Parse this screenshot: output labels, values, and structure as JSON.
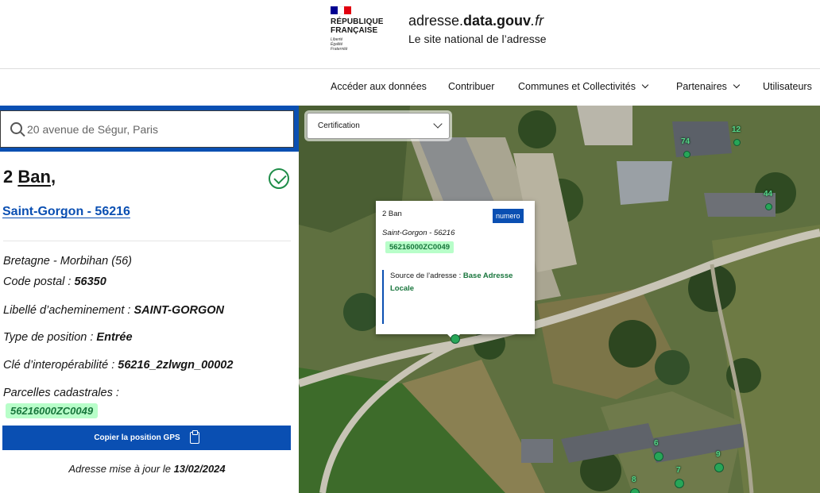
{
  "header": {
    "republic_line1": "RÉPUBLIQUE",
    "republic_line2": "FRANÇAISE",
    "motto": [
      "Liberté",
      "Égalité",
      "Fraternité"
    ],
    "site_title_plain": "adresse.",
    "site_title_bold": "data.gouv",
    "site_title_ext": ".fr",
    "tagline": "Le site national de l’adresse",
    "flag_colors": [
      "#000091",
      "#ffffff",
      "#e1000f"
    ]
  },
  "nav": {
    "items": [
      {
        "label": "Accéder aux données",
        "dropdown": false
      },
      {
        "label": "Contribuer",
        "dropdown": false
      },
      {
        "label": "Communes et Collectivités",
        "dropdown": true
      },
      {
        "label": "Partenaires",
        "dropdown": true
      },
      {
        "label": "Utilisateurs",
        "dropdown": false
      }
    ]
  },
  "search": {
    "placeholder": "20 avenue de Ségur, Paris",
    "icon": "search-icon"
  },
  "address": {
    "number": "2",
    "street": "Ban",
    "suffix": ",",
    "commune_link": "Saint-Gorgon - 56216",
    "certified_icon": "check-circle-icon",
    "region": "Bretagne - Morbihan (56)",
    "fields": [
      {
        "label": "Code postal : ",
        "value": "56350"
      },
      {
        "label": "Libellé d’acheminement : ",
        "value": "SAINT-GORGON"
      },
      {
        "label": "Type de position : ",
        "value": "Entrée"
      },
      {
        "label": "Clé d’interopérabilité : ",
        "value": "56216_2zlwgn_00002"
      }
    ],
    "parcels_label": "Parcelles cadastrales :",
    "parcel": "56216000ZC0049",
    "gps_button": "Copier la position GPS",
    "updated_prefix": "Adresse mise à jour le ",
    "updated_date": "13/02/2024"
  },
  "map": {
    "filter_select": "Certification",
    "popup": {
      "title": "2 Ban",
      "badge": "numero",
      "commune": "Saint-Gorgon - 56216",
      "parcel": "56216000ZC0049",
      "source_label": "Source de l’adresse : ",
      "source_value": "Base Adresse Locale"
    },
    "markers": [
      "74",
      "12",
      "44",
      "6",
      "9",
      "7",
      "8"
    ],
    "marker_color": "#27a658"
  }
}
